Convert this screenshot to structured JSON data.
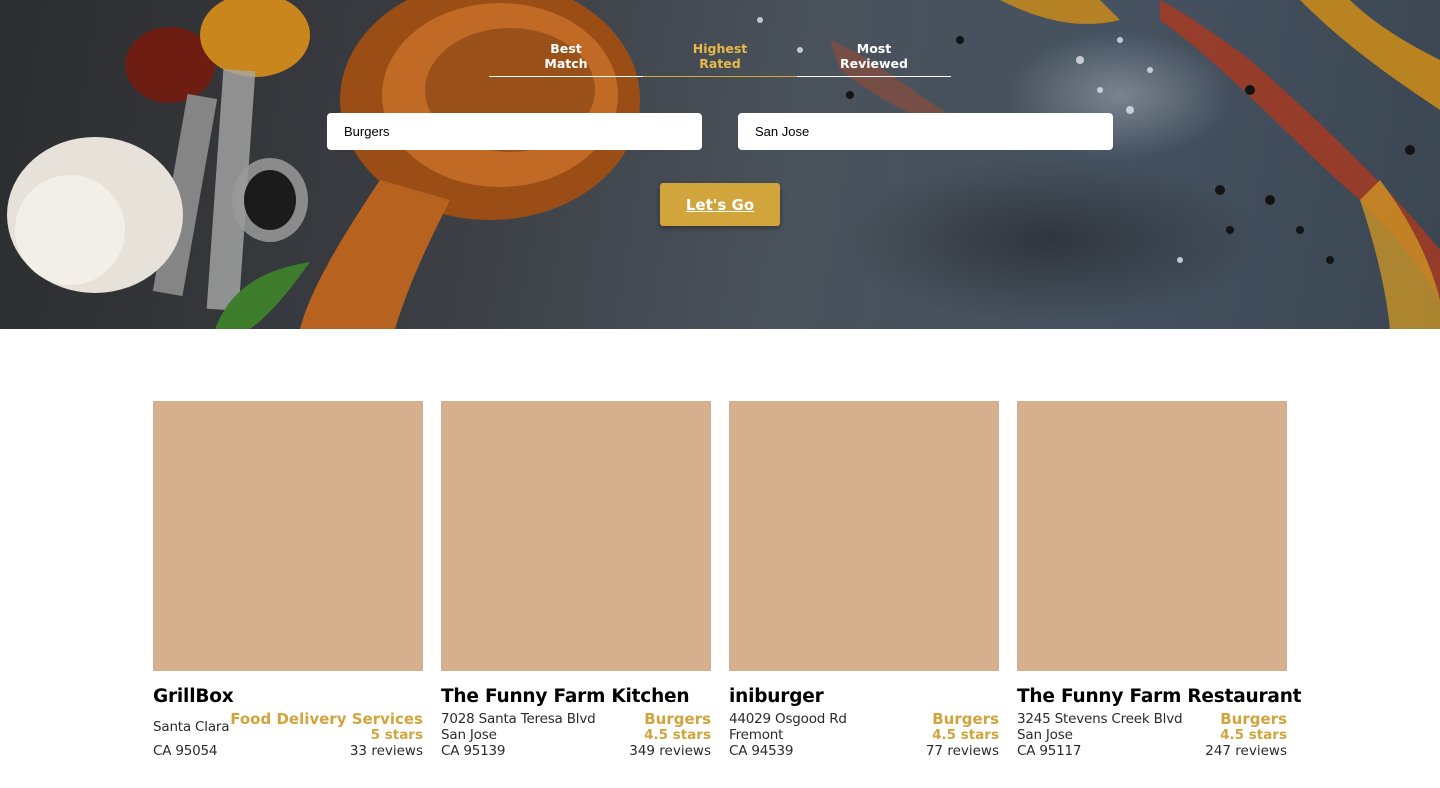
{
  "hero": {
    "tabs": [
      {
        "line1": "Best",
        "line2": "Match",
        "active": false
      },
      {
        "line1": "Highest",
        "line2": "Rated",
        "active": true
      },
      {
        "line1": "Most",
        "line2": "Reviewed",
        "active": false
      }
    ],
    "search_term": {
      "value": "Burgers"
    },
    "location": {
      "value": "San Jose"
    },
    "submit_label": "Let's Go",
    "colors": {
      "accent": "#d1a43c",
      "active_tab": "#e9b949"
    }
  },
  "businesses": [
    {
      "name": "GrillBox",
      "address1": "Santa Clara",
      "address2": "CA 95054",
      "category": "Food Delivery Services",
      "rating": "5 stars",
      "reviews": "33 reviews"
    },
    {
      "name": "The Funny Farm Kitchen",
      "address1": "7028 Santa Teresa Blvd",
      "city": "San Jose",
      "address2": "CA 95139",
      "category": "Burgers",
      "rating": "4.5 stars",
      "reviews": "349 reviews"
    },
    {
      "name": "iniburger",
      "address1": "44029 Osgood Rd",
      "city": "Fremont",
      "address2": "CA 94539",
      "category": "Burgers",
      "rating": "4.5 stars",
      "reviews": "77 reviews"
    },
    {
      "name": "The Funny Farm Restaurant",
      "address1": "3245 Stevens Creek Blvd",
      "city": "San Jose",
      "address2": "CA 95117",
      "category": "Burgers",
      "rating": "4.5 stars",
      "reviews": "247 reviews"
    }
  ]
}
